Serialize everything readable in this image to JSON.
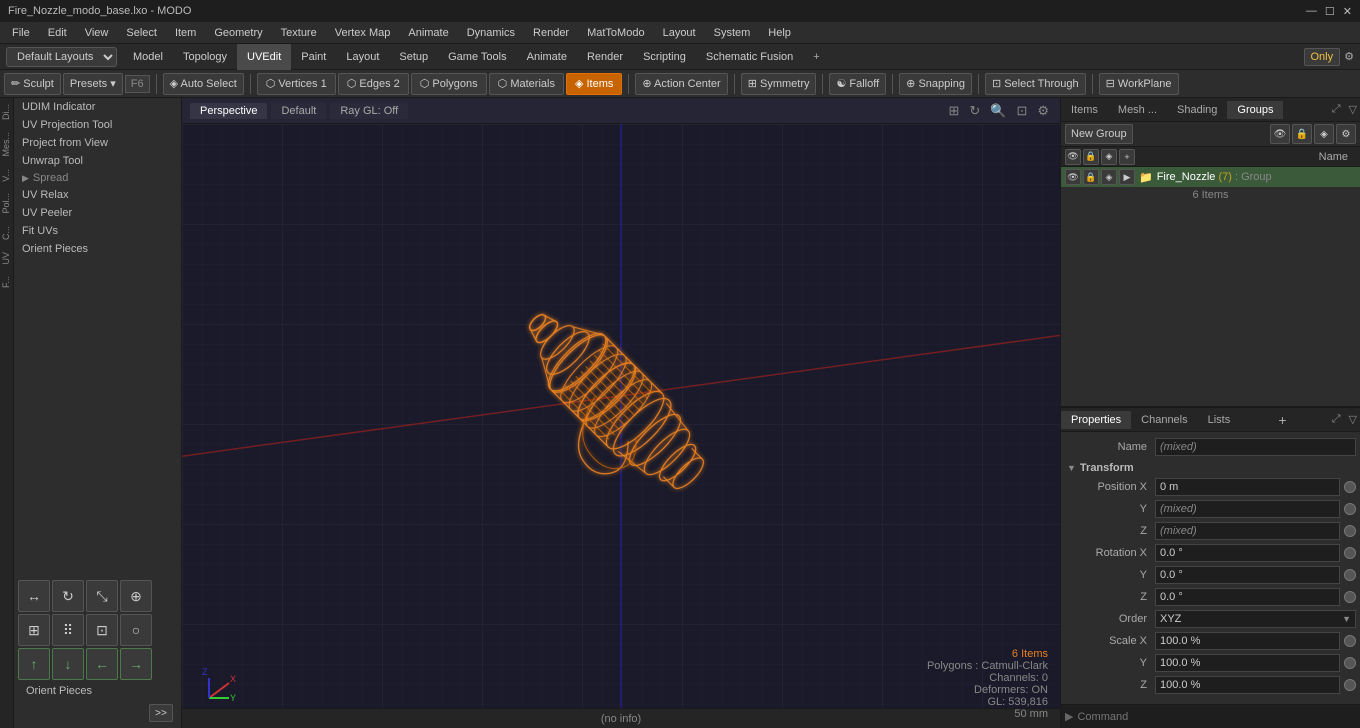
{
  "titlebar": {
    "title": "Fire_Nozzle_modo_base.lxo - MODO",
    "controls": [
      "—",
      "☐",
      "✕"
    ]
  },
  "menubar": {
    "items": [
      "File",
      "Edit",
      "View",
      "Select",
      "Item",
      "Geometry",
      "Texture",
      "Vertex Map",
      "Animate",
      "Dynamics",
      "Render",
      "MatToModo",
      "Layout",
      "System",
      "Help"
    ]
  },
  "layout_bar": {
    "selector": "Default Layouts",
    "tabs": [
      "Model",
      "Topology",
      "UVEdit",
      "Paint",
      "Layout",
      "Setup",
      "Game Tools",
      "Animate",
      "Render",
      "Scripting",
      "Schematic Fusion"
    ],
    "active_tab": "UVEdit",
    "plus_label": "+",
    "only_label": "Only",
    "gear_label": "⚙"
  },
  "toolbar": {
    "sculpt_label": "Sculpt",
    "presets_label": "Presets",
    "f6_label": "F6",
    "auto_select_label": "Auto Select",
    "vertices_label": "Vertices",
    "vertices_count": "1",
    "edges_label": "Edges",
    "edges_count": "2",
    "polygons_label": "Polygons",
    "materials_label": "Materials",
    "items_label": "Items",
    "action_center_label": "Action Center",
    "symmetry_label": "Symmetry",
    "falloff_label": "Falloff",
    "snapping_label": "Snapping",
    "select_through_label": "Select Through",
    "workplane_label": "WorkPlane"
  },
  "left_panel": {
    "items": [
      "UDIM Indicator",
      "UV Projection Tool",
      "Project from View",
      "Unwrap Tool",
      "Spread",
      "UV Relax",
      "UV Peeler",
      "Fit UVs",
      "Orient Pieces"
    ],
    "strip_labels": [
      "Di...",
      "Mes...",
      "V...",
      "Pol...",
      "C...",
      "UV",
      "F..."
    ]
  },
  "viewport": {
    "tabs": [
      "Perspective",
      "Default",
      "Ray GL: Off"
    ],
    "active_tab": "Perspective",
    "info": {
      "items": "6 Items",
      "polygons": "Polygons : Catmull-Clark",
      "channels": "Channels: 0",
      "deformers": "Deformers: ON",
      "gl": "GL: 539,816",
      "size": "50 mm"
    },
    "status": "(no info)"
  },
  "right_panel": {
    "items_tabs": [
      "Items",
      "Mesh ...",
      "Shading",
      "Groups"
    ],
    "active_items_tab": "Groups",
    "new_group_label": "New Group",
    "col_header": "Name",
    "group_item": {
      "name": "Fire_Nozzle",
      "badge": "(7)",
      "type": ": Group",
      "sub": "6 Items"
    },
    "props_tabs": [
      "Properties",
      "Channels",
      "Lists"
    ],
    "active_props_tab": "Properties",
    "props": {
      "name_label": "Name",
      "name_value": "(mixed)",
      "transform_label": "Transform",
      "position_x_label": "Position X",
      "position_x_value": "0 m",
      "position_y_label": "Y",
      "position_y_value": "(mixed)",
      "position_z_label": "Z",
      "position_z_value": "(mixed)",
      "rotation_x_label": "Rotation X",
      "rotation_x_value": "0.0 °",
      "rotation_y_label": "Y",
      "rotation_y_value": "0.0 °",
      "rotation_z_label": "Z",
      "rotation_z_value": "0.0 °",
      "order_label": "Order",
      "order_value": "XYZ",
      "scale_x_label": "Scale X",
      "scale_x_value": "100.0 %",
      "scale_y_label": "Y",
      "scale_y_value": "100.0 %",
      "scale_z_label": "Z",
      "scale_z_value": "100.0 %"
    },
    "command_placeholder": "Command"
  },
  "colors": {
    "active_tab_bg": "#c86400",
    "viewport_bg": "#1a1a2a",
    "grid_line": "#2a2a3a",
    "model_color": "#e88020",
    "model_wire": "#cc6600",
    "item_highlight": "#3a5a3a",
    "accent_orange": "#e88020"
  }
}
